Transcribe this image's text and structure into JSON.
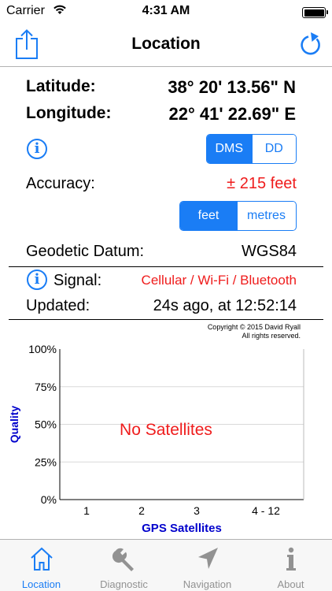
{
  "status_bar": {
    "carrier": "Carrier",
    "time": "4:31 AM"
  },
  "nav": {
    "title": "Location",
    "share_icon": "share-icon",
    "refresh_icon": "refresh-icon"
  },
  "position": {
    "latitude_label": "Latitude:",
    "latitude_value": "38° 20' 13.56\" N",
    "longitude_label": "Longitude:",
    "longitude_value": "22° 41' 22.69\" E"
  },
  "format_toggle": {
    "options": [
      "DMS",
      "DD"
    ],
    "selected": "DMS"
  },
  "accuracy": {
    "label": "Accuracy:",
    "value": "± 215 feet"
  },
  "unit_toggle": {
    "options": [
      "feet",
      "metres"
    ],
    "selected": "feet"
  },
  "datum": {
    "label": "Geodetic Datum:",
    "value": "WGS84"
  },
  "signal": {
    "label": "Signal:",
    "value": "Cellular / Wi-Fi / Bluetooth"
  },
  "updated": {
    "label": "Updated:",
    "value": "24s ago, at 12:52:14"
  },
  "copyright": {
    "line1": "Copyright © 2015 David Ryall",
    "line2": "All rights reserved."
  },
  "chart_data": {
    "type": "bar",
    "title": "",
    "xlabel": "GPS Satellites",
    "ylabel": "Quality",
    "categories": [
      "1",
      "2",
      "3",
      "4 - 12"
    ],
    "values": [],
    "ylim": [
      0,
      100
    ],
    "yticks": [
      "100%",
      "75%",
      "50%",
      "25%",
      "0%"
    ],
    "grid": true,
    "empty_message": "No Satellites"
  },
  "tabs": [
    {
      "label": "Location",
      "icon": "home-icon",
      "active": true
    },
    {
      "label": "Diagnostic",
      "icon": "wrench-icon",
      "active": false
    },
    {
      "label": "Navigation",
      "icon": "navigation-arrow-icon",
      "active": false
    },
    {
      "label": "About",
      "icon": "info-icon",
      "active": false
    }
  ],
  "colors": {
    "accent": "#1a7df5",
    "alert": "#ef1c1c",
    "axis_label": "#0000cc"
  }
}
